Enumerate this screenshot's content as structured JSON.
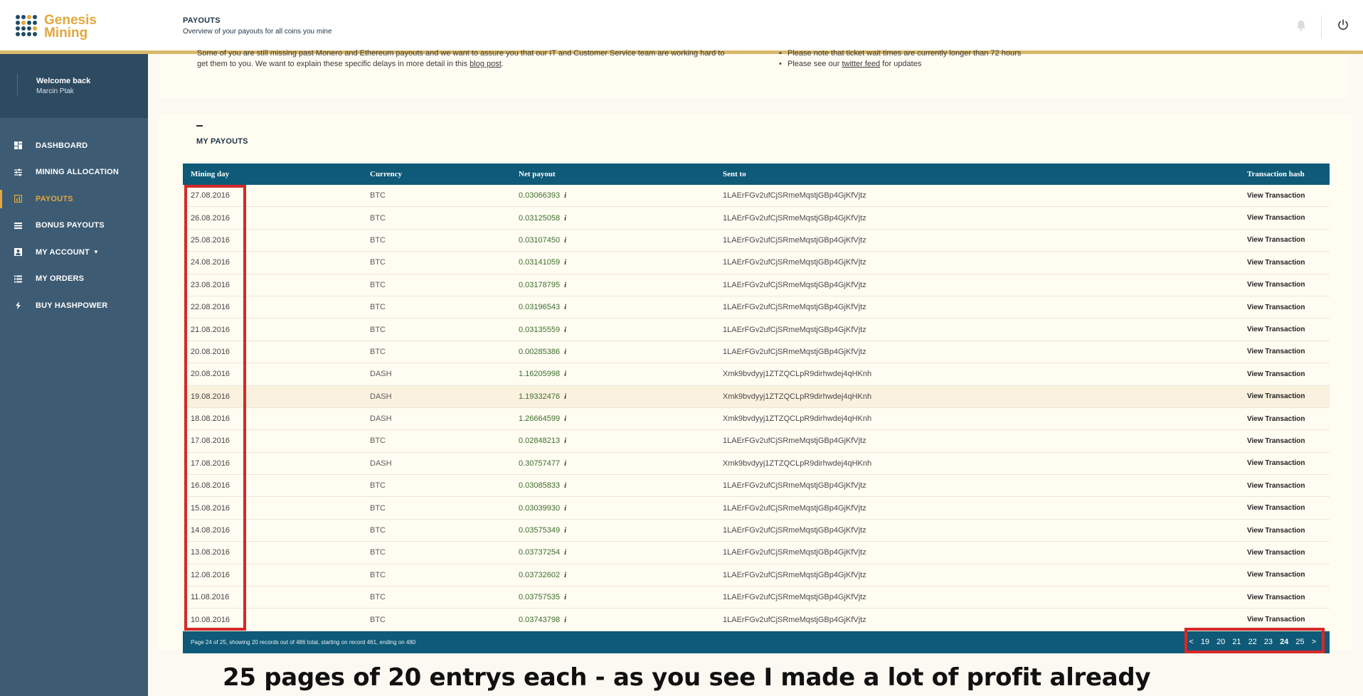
{
  "brand": {
    "line1": "Genesis",
    "line2": "Mining"
  },
  "header": {
    "title": "PAYOUTS",
    "subtitle": "Overview of your payouts for all coins you mine",
    "icons": [
      "bell-icon",
      "power-icon"
    ]
  },
  "sidebar": {
    "welcome_title": "Welcome back",
    "user_name": "Marcin Ptak",
    "items": [
      {
        "label": "DASHBOARD",
        "icon": "dashboard-icon",
        "active": false
      },
      {
        "label": "MINING ALLOCATION",
        "icon": "sliders-icon",
        "active": false
      },
      {
        "label": "PAYOUTS",
        "icon": "payouts-icon",
        "active": true
      },
      {
        "label": "BONUS PAYOUTS",
        "icon": "list-icon",
        "active": false
      },
      {
        "label": "MY ACCOUNT",
        "icon": "account-icon",
        "active": false,
        "dropdown": true
      },
      {
        "label": "MY ORDERS",
        "icon": "orders-icon",
        "active": false
      },
      {
        "label": "BUY HASHPOWER",
        "icon": "bolt-icon",
        "active": false
      }
    ]
  },
  "notice": {
    "left_line1": "Some of you are still missing past Monero and Ethereum payouts and we want to assure you that our IT and Customer Service team are working hard to",
    "left_line2_pre": "get them to you. We want to explain these specific delays in more detail in this ",
    "left_link": "blog post",
    "left_line2_post": ".",
    "right_item1": "Please note that ticket wait times are currently longer than 72 hours",
    "right_item2_pre": "Please see our ",
    "right_item2_link": "twitter feed",
    "right_item2_post": " for updates"
  },
  "payouts": {
    "section_title": "MY PAYOUTS",
    "columns": [
      "Mining day",
      "Currency",
      "Net payout",
      "Sent to",
      "Transaction hash"
    ],
    "rows": [
      [
        "27.08.2016",
        "BTC",
        "0.03066393",
        "1LAErFGv2ufCjSRmeMqstjGBp4GjKfVjtz",
        "View Transaction"
      ],
      [
        "26.08.2016",
        "BTC",
        "0.03125058",
        "1LAErFGv2ufCjSRmeMqstjGBp4GjKfVjtz",
        "View Transaction"
      ],
      [
        "25.08.2016",
        "BTC",
        "0.03107450",
        "1LAErFGv2ufCjSRmeMqstjGBp4GjKfVjtz",
        "View Transaction"
      ],
      [
        "24.08.2016",
        "BTC",
        "0.03141059",
        "1LAErFGv2ufCjSRmeMqstjGBp4GjKfVjtz",
        "View Transaction"
      ],
      [
        "23.08.2016",
        "BTC",
        "0.03178795",
        "1LAErFGv2ufCjSRmeMqstjGBp4GjKfVjtz",
        "View Transaction"
      ],
      [
        "22.08.2016",
        "BTC",
        "0.03196543",
        "1LAErFGv2ufCjSRmeMqstjGBp4GjKfVjtz",
        "View Transaction"
      ],
      [
        "21.08.2016",
        "BTC",
        "0.03135559",
        "1LAErFGv2ufCjSRmeMqstjGBp4GjKfVjtz",
        "View Transaction"
      ],
      [
        "20.08.2016",
        "BTC",
        "0.00285386",
        "1LAErFGv2ufCjSRmeMqstjGBp4GjKfVjtz",
        "View Transaction"
      ],
      [
        "20.08.2016",
        "DASH",
        "1.16205998",
        "Xmk9bvdyyj1ZTZQCLpR9dirhwdej4qHKnh",
        "View Transaction"
      ],
      [
        "19.08.2016",
        "DASH",
        "1.19332476",
        "Xmk9bvdyyj1ZTZQCLpR9dirhwdej4qHKnh",
        "View Transaction"
      ],
      [
        "18.08.2016",
        "DASH",
        "1.26664599",
        "Xmk9bvdyyj1ZTZQCLpR9dirhwdej4qHKnh",
        "View Transaction"
      ],
      [
        "17.08.2016",
        "BTC",
        "0.02848213",
        "1LAErFGv2ufCjSRmeMqstjGBp4GjKfVjtz",
        "View Transaction"
      ],
      [
        "17.08.2016",
        "DASH",
        "0.30757477",
        "Xmk9bvdyyj1ZTZQCLpR9dirhwdej4qHKnh",
        "View Transaction"
      ],
      [
        "16.08.2016",
        "BTC",
        "0.03085833",
        "1LAErFGv2ufCjSRmeMqstjGBp4GjKfVjtz",
        "View Transaction"
      ],
      [
        "15.08.2016",
        "BTC",
        "0.03039930",
        "1LAErFGv2ufCjSRmeMqstjGBp4GjKfVjtz",
        "View Transaction"
      ],
      [
        "14.08.2016",
        "BTC",
        "0.03575349",
        "1LAErFGv2ufCjSRmeMqstjGBp4GjKfVjtz",
        "View Transaction"
      ],
      [
        "13.08.2016",
        "BTC",
        "0.03737254",
        "1LAErFGv2ufCjSRmeMqstjGBp4GjKfVjtz",
        "View Transaction"
      ],
      [
        "12.08.2016",
        "BTC",
        "0.03732602",
        "1LAErFGv2ufCjSRmeMqstjGBp4GjKfVjtz",
        "View Transaction"
      ],
      [
        "11.08.2016",
        "BTC",
        "0.03757535",
        "1LAErFGv2ufCjSRmeMqstjGBp4GjKfVjtz",
        "View Transaction"
      ],
      [
        "10.08.2016",
        "BTC",
        "0.03743798",
        "1LAErFGv2ufCjSRmeMqstjGBp4GjKfVjtz",
        "View Transaction"
      ]
    ],
    "highlighted_row": 9,
    "footer_text": "Page 24 of 25, showing 20 records out of 486 total, starting on record 461, ending on 480",
    "pager": {
      "prev": "<",
      "pages": [
        "19",
        "20",
        "21",
        "22",
        "23",
        "24",
        "25"
      ],
      "current": "24",
      "next": ">"
    }
  },
  "caption": "25 pages of 20 entrys each - as you see I made a lot of profit already",
  "colors": {
    "accent": "#e3a73c",
    "sidebar": "#3d5b73",
    "table_header": "#0e5a78",
    "annotation": "#d62828"
  }
}
